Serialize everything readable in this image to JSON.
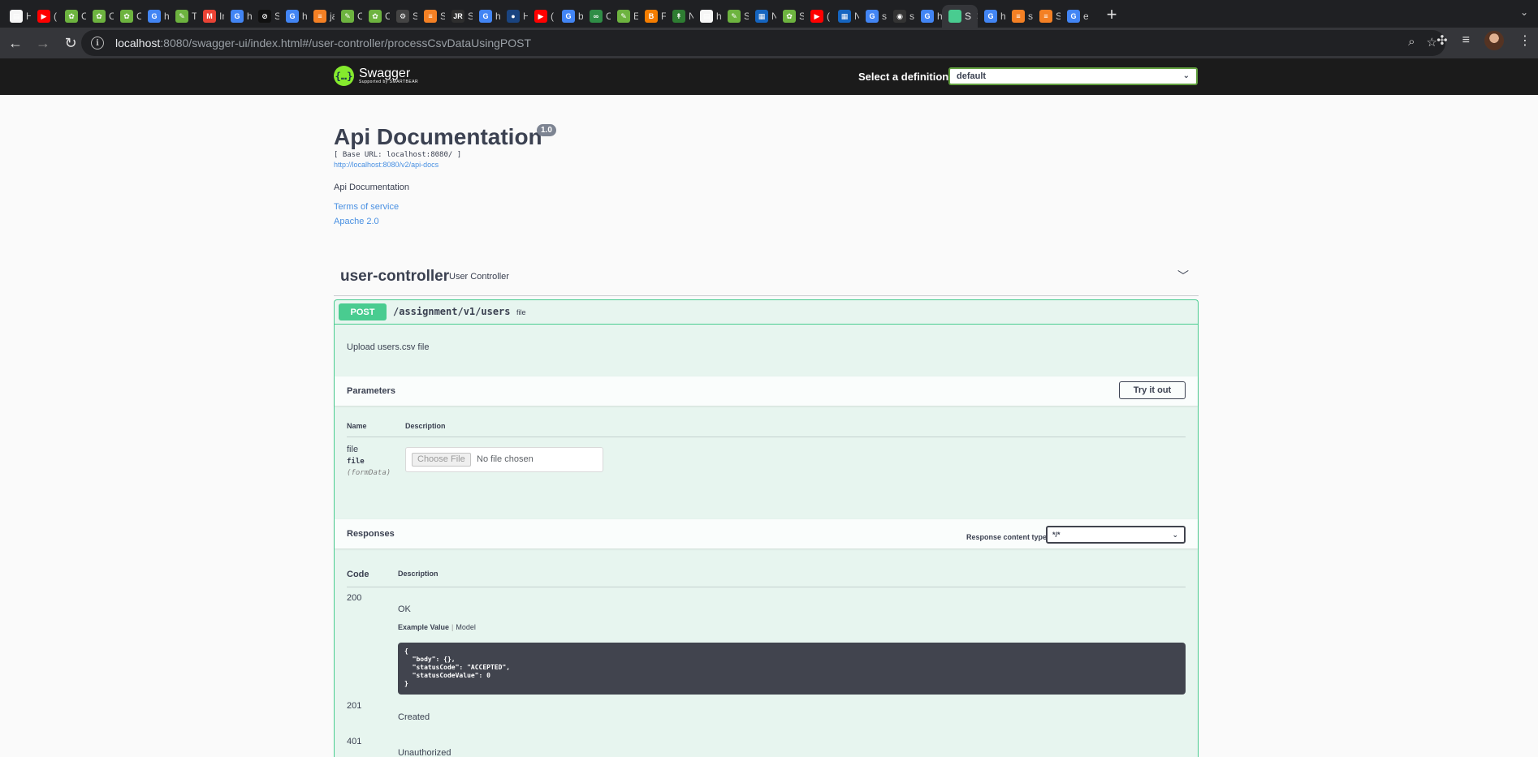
{
  "browser": {
    "tabs": [
      {
        "label": "H",
        "color": "#f5f5f5",
        "glyph": "▤"
      },
      {
        "label": "(",
        "color": "#ff0000",
        "glyph": "▶"
      },
      {
        "label": "C",
        "color": "#6db33f",
        "glyph": "✿"
      },
      {
        "label": "C",
        "color": "#6db33f",
        "glyph": "✿"
      },
      {
        "label": "C",
        "color": "#6db33f",
        "glyph": "✿"
      },
      {
        "label": "h",
        "color": "#4285f4",
        "glyph": "G"
      },
      {
        "label": "T",
        "color": "#6db33f",
        "glyph": "✎"
      },
      {
        "label": "In",
        "color": "#ea4335",
        "glyph": "M"
      },
      {
        "label": "h",
        "color": "#4285f4",
        "glyph": "G"
      },
      {
        "label": "S",
        "color": "#111111",
        "glyph": "⊘"
      },
      {
        "label": "h",
        "color": "#4285f4",
        "glyph": "G"
      },
      {
        "label": "ja",
        "color": "#f48024",
        "glyph": "≡"
      },
      {
        "label": "C",
        "color": "#6db33f",
        "glyph": "✎"
      },
      {
        "label": "C",
        "color": "#6db33f",
        "glyph": "✿"
      },
      {
        "label": "S",
        "color": "#444444",
        "glyph": "⚙"
      },
      {
        "label": "S",
        "color": "#f48024",
        "glyph": "≡"
      },
      {
        "label": "S",
        "color": "#2e2e2e",
        "glyph": "JR"
      },
      {
        "label": "h",
        "color": "#4285f4",
        "glyph": "G"
      },
      {
        "label": "H",
        "color": "#1a4480",
        "glyph": "●"
      },
      {
        "label": "(",
        "color": "#ff0000",
        "glyph": "▶"
      },
      {
        "label": "b",
        "color": "#4285f4",
        "glyph": "G"
      },
      {
        "label": "C",
        "color": "#2f8d46",
        "glyph": "∞"
      },
      {
        "label": "E",
        "color": "#6db33f",
        "glyph": "✎"
      },
      {
        "label": "F",
        "color": "#f57d00",
        "glyph": "B"
      },
      {
        "label": "N",
        "color": "#2e7d32",
        "glyph": "↟"
      },
      {
        "label": "h",
        "color": "#f5f5f5",
        "glyph": "▤"
      },
      {
        "label": "S",
        "color": "#6db33f",
        "glyph": "✎"
      },
      {
        "label": "N",
        "color": "#1565c0",
        "glyph": "▦"
      },
      {
        "label": "S",
        "color": "#6db33f",
        "glyph": "✿"
      },
      {
        "label": "(",
        "color": "#ff0000",
        "glyph": "▶"
      },
      {
        "label": "N",
        "color": "#1565c0",
        "glyph": "▦"
      },
      {
        "label": "s",
        "color": "#4285f4",
        "glyph": "G"
      },
      {
        "label": "s",
        "color": "#333333",
        "glyph": "◉"
      },
      {
        "label": "h",
        "color": "#4285f4",
        "glyph": "G"
      },
      {
        "label": "S",
        "color": "#49cc90",
        "glyph": "",
        "active": true
      },
      {
        "label": "h",
        "color": "#4285f4",
        "glyph": "G"
      },
      {
        "label": "s",
        "color": "#f48024",
        "glyph": "≡"
      },
      {
        "label": "S",
        "color": "#f48024",
        "glyph": "≡"
      },
      {
        "label": "e",
        "color": "#4285f4",
        "glyph": "G"
      }
    ],
    "url_host": "localhost",
    "url_path": ":8080/swagger-ui/index.html#/user-controller/processCsvDataUsingPOST"
  },
  "swagger": {
    "logo_text": "Swagger",
    "logo_sub": "Supported by SMARTBEAR",
    "select_definition_label": "Select a definition",
    "definition_value": "default"
  },
  "info": {
    "title": "Api Documentation",
    "version": "1.0",
    "base_url": "[ Base URL: localhost:8080/ ]",
    "api_docs_link": "http://localhost:8080/v2/api-docs",
    "description": "Api Documentation",
    "terms": "Terms of service",
    "license": "Apache 2.0"
  },
  "controller": {
    "name": "user-controller",
    "description": "User Controller",
    "operation": {
      "method": "POST",
      "path": "/assignment/v1/users",
      "path_desc": "file",
      "description": "Upload users.csv file",
      "parameters_title": "Parameters",
      "try_it_out": "Try it out",
      "col_name": "Name",
      "col_description": "Description",
      "param": {
        "name": "file",
        "type": "file",
        "in": "(formData)",
        "choose_file": "Choose File",
        "no_file": "No file chosen"
      },
      "responses_title": "Responses",
      "response_content_type_label": "Response content type",
      "response_content_type": "*/*",
      "col_code": "Code",
      "responses": [
        {
          "code": "200",
          "description": "OK"
        },
        {
          "code": "201",
          "description": "Created"
        },
        {
          "code": "401",
          "description": "Unauthorized"
        }
      ],
      "example_value_tab": "Example Value",
      "model_tab": "Model",
      "example_json": "{\n  \"body\": {},\n  \"statusCode\": \"ACCEPTED\",\n  \"statusCodeValue\": 0\n}"
    }
  }
}
